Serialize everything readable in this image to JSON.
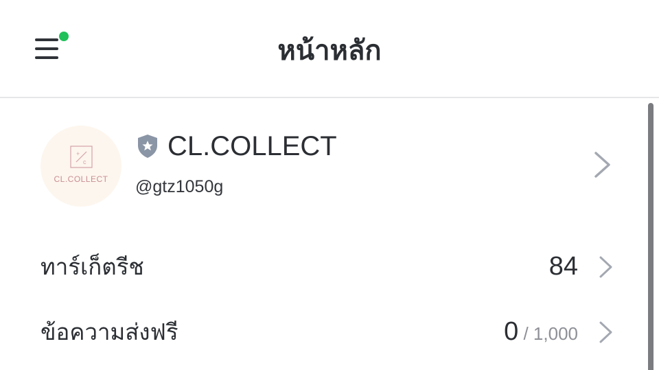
{
  "header": {
    "title": "หน้าหลัก",
    "menu_icon": "hamburger-menu-icon",
    "notification_dot_color": "#21c05a"
  },
  "profile": {
    "avatar_logo_text": "CL.COLLECT",
    "badge_icon": "shield-star-icon",
    "name": "CL.COLLECT",
    "account_id": "@gtz1050g",
    "chevron_icon": "chevron-right-icon"
  },
  "rows": [
    {
      "label": "ทาร์เก็ตรีช",
      "value": "84",
      "limit": ""
    },
    {
      "label": "ข้อความส่งฟรี",
      "value": "0",
      "limit": " / 1,000"
    }
  ]
}
